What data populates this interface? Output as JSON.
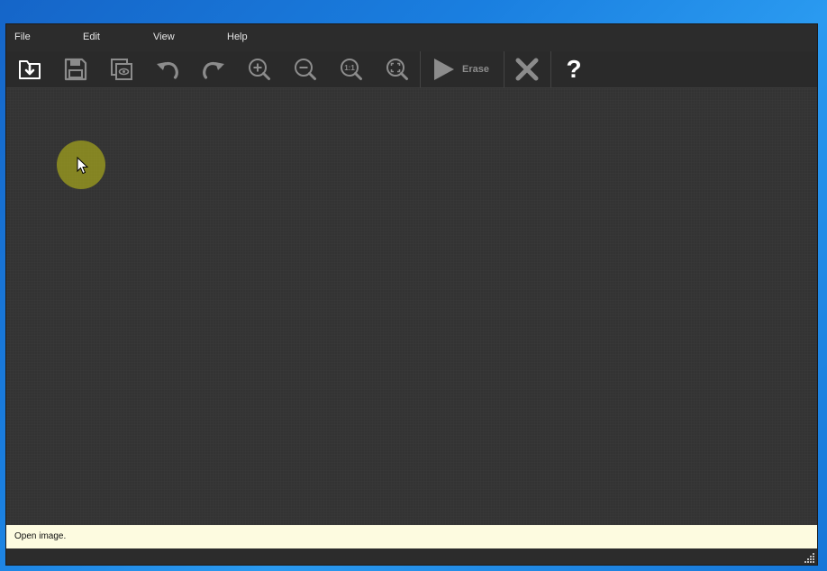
{
  "menu": {
    "items": [
      {
        "label": "File"
      },
      {
        "label": "Edit"
      },
      {
        "label": "View"
      },
      {
        "label": "Help"
      }
    ]
  },
  "toolbar": {
    "buttons": [
      {
        "icon": "open-file-icon"
      },
      {
        "icon": "save-icon"
      },
      {
        "icon": "preview-icon"
      },
      {
        "icon": "undo-icon"
      },
      {
        "icon": "redo-icon"
      },
      {
        "icon": "zoom-in-icon"
      },
      {
        "icon": "zoom-out-icon"
      },
      {
        "icon": "zoom-actual-size-icon"
      },
      {
        "icon": "zoom-fit-icon"
      },
      {
        "icon": "play-icon"
      },
      {
        "icon": "close-icon"
      },
      {
        "icon": "help-icon"
      }
    ],
    "erase_label": "Erase",
    "help_glyph": "?",
    "zoom_actual_glyph": "1:1"
  },
  "status": {
    "text": "Open image."
  },
  "colors": {
    "window_bg": "#2f2f2f",
    "status_bg": "#fdfbe0",
    "click_indicator": "#a0a01e",
    "icon_active": "#ffffff",
    "icon_disabled": "#8c8c8c",
    "desktop": "#1a7fe0"
  }
}
